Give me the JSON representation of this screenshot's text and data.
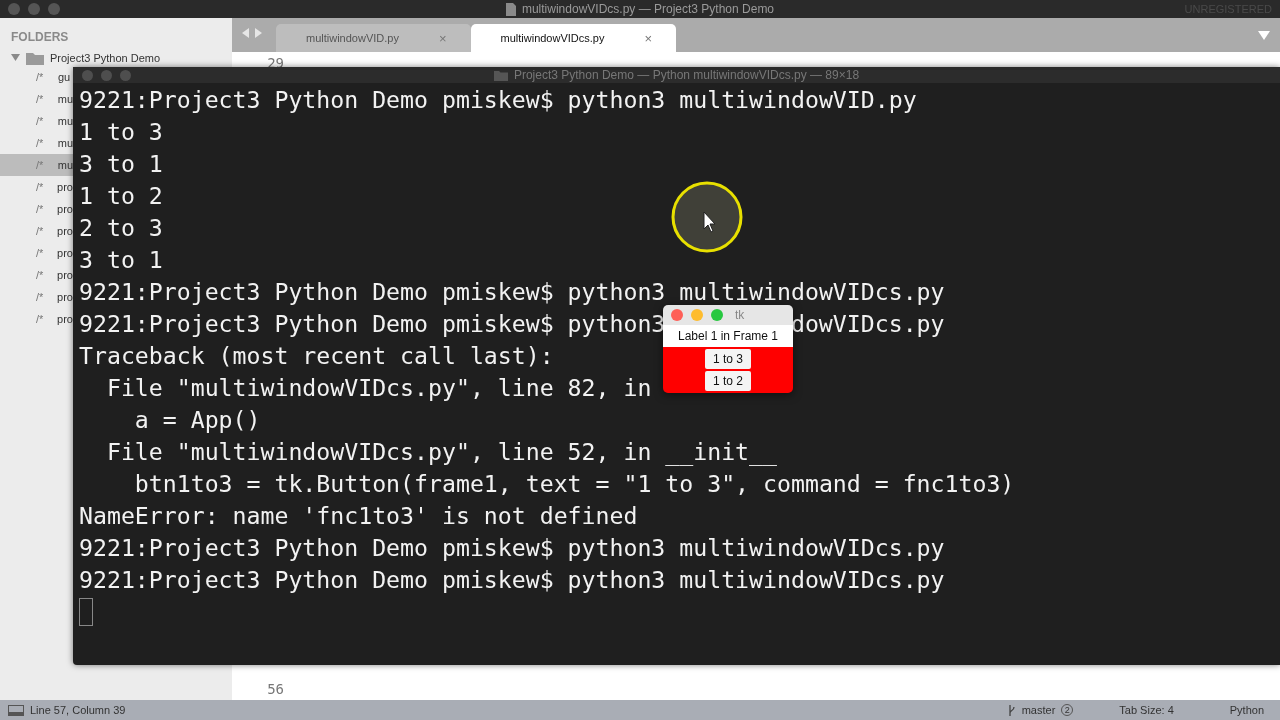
{
  "window": {
    "title": "multiwindowVIDcs.py — Project3 Python Demo",
    "badge": "UNREGISTERED"
  },
  "sidebar": {
    "heading": "FOLDERS",
    "folder": {
      "name": "Project3 Python Demo",
      "expanded": true
    },
    "items": [
      {
        "marker": "/*",
        "name": "gu",
        "selected": false
      },
      {
        "marker": "/*",
        "name": "mu",
        "selected": false
      },
      {
        "marker": "/*",
        "name": "mu",
        "selected": false
      },
      {
        "marker": "/*",
        "name": "mu",
        "selected": false
      },
      {
        "marker": "/*",
        "name": "mu",
        "selected": true
      },
      {
        "marker": "/*",
        "name": "pro",
        "selected": false
      },
      {
        "marker": "/*",
        "name": "pro",
        "selected": false
      },
      {
        "marker": "/*",
        "name": "pro",
        "selected": false
      },
      {
        "marker": "/*",
        "name": "pro",
        "selected": false
      },
      {
        "marker": "/*",
        "name": "pro",
        "selected": false
      },
      {
        "marker": "/*",
        "name": "pro",
        "selected": false
      },
      {
        "marker": "/*",
        "name": "pro",
        "selected": false
      }
    ]
  },
  "tabs": [
    {
      "label": "multiwindowVID.py",
      "close": "×",
      "selected": false
    },
    {
      "label": "multiwindowVIDcs.py",
      "close": "×",
      "selected": true
    }
  ],
  "editor": {
    "line_numbers": [
      "29",
      "56"
    ]
  },
  "terminal": {
    "title": "Project3 Python Demo — Python multiwindowVIDcs.py — 89×18",
    "lines": [
      {
        "parts": [
          "9221:Project3 Python Demo pmiskew$ python3 multiwindowVID.py"
        ]
      },
      {
        "parts": [
          "1 to 3"
        ]
      },
      {
        "parts": [
          "3 to 1"
        ]
      },
      {
        "parts": [
          "1 to 2"
        ]
      },
      {
        "parts": [
          "2 to 3"
        ]
      },
      {
        "parts": [
          "3 to 1"
        ]
      },
      {
        "parts": [
          "9221:Project3 Python Demo pmiskew$ python3 multiwindowVIDcs.py"
        ]
      },
      {
        "parts": [
          "9221:Project3 Python Demo pmiskew$ python3",
          "dowVIDcs.py"
        ]
      },
      {
        "parts": [
          "Traceback (most recent call last):"
        ]
      },
      {
        "parts": [
          "  File \"multiwindowVIDcs.py\", line 82, in"
        ]
      },
      {
        "parts": [
          "    a = App()"
        ]
      },
      {
        "parts": [
          "  File \"multiwindowVIDcs.py\", line 52, in __init__"
        ]
      },
      {
        "parts": [
          "    btn1to3 = tk.Button(frame1, text = \"1 to 3\", command = fnc1to3)"
        ]
      },
      {
        "parts": [
          "NameError: name 'fnc1to3' is not defined"
        ]
      },
      {
        "parts": [
          "9221:Project3 Python Demo pmiskew$ python3 multiwindowVIDcs.py"
        ]
      },
      {
        "parts": [
          "9221:Project3 Python Demo pmiskew$ python3 multiwindowVIDcs.py"
        ]
      }
    ]
  },
  "tk_window": {
    "title": "tk",
    "label": "Label 1 in Frame 1",
    "buttons": [
      "1 to 3",
      "1 to 2"
    ]
  },
  "status_bar": {
    "position": "Line 57, Column 39",
    "branch": "master",
    "changes": "2",
    "tab_size": "Tab Size: 4",
    "syntax": "Python"
  }
}
